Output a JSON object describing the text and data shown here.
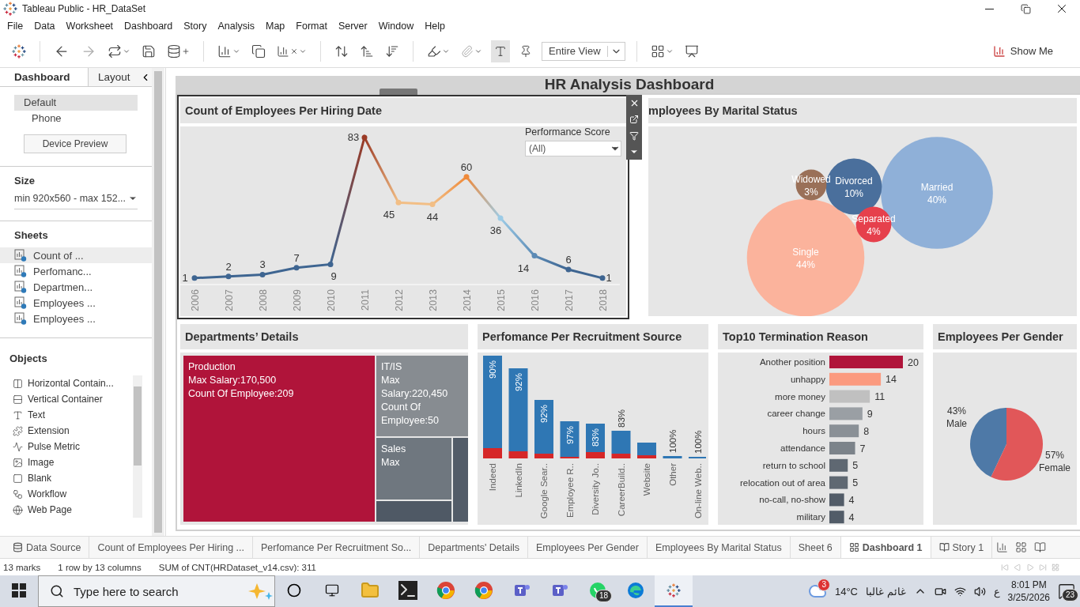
{
  "window": {
    "title": "Tableau Public - HR_DataSet"
  },
  "menu": [
    "File",
    "Data",
    "Worksheet",
    "Dashboard",
    "Story",
    "Analysis",
    "Map",
    "Format",
    "Server",
    "Window",
    "Help"
  ],
  "toolbar": {
    "fit": "Entire View",
    "show_me": "Show Me"
  },
  "side_panel": {
    "tabs": [
      {
        "label": "Dashboard",
        "selected": true
      },
      {
        "label": "Layout",
        "selected": false
      }
    ],
    "devices": [
      {
        "label": "Default",
        "selected": true
      },
      {
        "label": "Phone",
        "selected": false
      }
    ],
    "device_preview": "Device Preview",
    "size": {
      "heading": "Size",
      "value": "min 920x560 - max 152..."
    },
    "sheets": {
      "heading": "Sheets",
      "items": [
        {
          "label": "Count of ...",
          "selected": true
        },
        {
          "label": "Perfomanc...",
          "selected": false
        },
        {
          "label": "Departmen...",
          "selected": false
        },
        {
          "label": "Employees ...",
          "selected": false
        },
        {
          "label": "Employees ...",
          "selected": false
        }
      ]
    },
    "objects": {
      "heading": "Objects",
      "items": [
        {
          "kind": "horizontal",
          "label": "Horizontal Contain..."
        },
        {
          "kind": "vertical",
          "label": "Vertical Container"
        },
        {
          "kind": "text",
          "label": "Text"
        },
        {
          "kind": "extension",
          "label": "Extension"
        },
        {
          "kind": "pulse",
          "label": "Pulse Metric"
        },
        {
          "kind": "image",
          "label": "Image"
        },
        {
          "kind": "blank",
          "label": "Blank"
        },
        {
          "kind": "workflow",
          "label": "Workflow"
        },
        {
          "kind": "webpage",
          "label": "Web Page"
        }
      ]
    }
  },
  "dashboard": {
    "title": "HR Analysis Dashboard",
    "hiring": {
      "title": "Count of Employees Per Hiring Date",
      "selected": true,
      "filter": {
        "label": "Performance Score",
        "value": "(All)"
      },
      "chart_data": {
        "type": "line",
        "categories": [
          "2006",
          "2007",
          "2008",
          "2009",
          "2010",
          "2011",
          "2012",
          "2013",
          "2014",
          "2015",
          "2016",
          "2017",
          "2018"
        ],
        "series": [
          {
            "color": "#3e6591",
            "marker": true,
            "values": [
              1,
              2,
              3,
              7,
              9,
              83,
              45,
              44,
              60,
              36,
              14,
              6,
              1
            ]
          }
        ],
        "data_labels": true
      }
    },
    "marital": {
      "title": "mployees By Marital Status",
      "bubbles": [
        {
          "label": "Single",
          "share": "44%",
          "color": "#fbb39c"
        },
        {
          "label": "Married",
          "share": "40%",
          "color": "#8fb0d8"
        },
        {
          "label": "Divorced",
          "share": "10%",
          "color": "#4a6f9c"
        },
        {
          "label": "Separated",
          "share": "4%",
          "color": "#e6404c"
        },
        {
          "label": "Widowed",
          "share": "3%",
          "color": "#9a7058"
        }
      ]
    },
    "departments": {
      "title": "Departments’ Details",
      "cells": [
        {
          "lines": [
            "Production",
            "Max Salary:170,500",
            "Count Of Employee:209"
          ],
          "color": "#b0143a"
        },
        {
          "lines": [
            "IT/IS",
            "Max Salary:220,450",
            "Count Of Employee:50"
          ],
          "color": "#878c91"
        },
        {
          "lines": [
            "Sales",
            "Max"
          ],
          "color": "#6f777f"
        },
        {
          "color": "#525c68"
        },
        {
          "color": "#4f5965"
        }
      ]
    },
    "recruitment": {
      "title": "Perfomance Per Recruitment Source",
      "sources": [
        {
          "label": "Indeed",
          "share": "90%"
        },
        {
          "label": "LinkedIn",
          "share": "92%"
        },
        {
          "label": "Google Sear..",
          "share": "92%"
        },
        {
          "label": "Employee R..",
          "share": "97%"
        },
        {
          "label": "Diversity Jo..",
          "share": "83%"
        },
        {
          "label": "CareerBuild..",
          "share": "83%"
        },
        {
          "label": "Website"
        },
        {
          "label": "Other",
          "share": "100%"
        },
        {
          "label": "On-line Web..",
          "share": "100%"
        }
      ]
    },
    "termination": {
      "title": "Top10 Termination Reason",
      "chart_data": {
        "type": "bar",
        "orientation": "horizontal",
        "categories": [
          "Another position",
          "unhappy",
          "more money",
          "career change",
          "hours",
          "attendance",
          "return to school",
          "relocation out of area",
          "no-call, no-show",
          "military"
        ],
        "series": [
          {
            "values": [
              20,
              14,
              11,
              9,
              8,
              7,
              5,
              5,
              4,
              4
            ]
          }
        ],
        "colors": [
          "#b0143a",
          "#fb9a7f",
          "#c0c0c0",
          "#9a9fa4",
          "#8a9096",
          "#7c838a",
          "#5f6872",
          "#5f6872",
          "#525c68",
          "#525c68"
        ],
        "data_labels": true
      }
    },
    "gender": {
      "title": "Employees Per Gender",
      "chart_data": {
        "type": "pie",
        "categories": [
          "Male",
          "Female"
        ],
        "values": [
          43,
          57
        ],
        "value_labels": [
          "43%",
          "57%"
        ],
        "colors": [
          "#4e79a7",
          "#e15759"
        ]
      }
    }
  },
  "sheet_tabs": [
    {
      "kind": "datasource",
      "label": "Data Source",
      "selected": false
    },
    {
      "kind": "worksheet",
      "label": "Count of Employees Per Hiring ...",
      "selected": false
    },
    {
      "kind": "worksheet",
      "label": "Perfomance Per Recruitment So...",
      "selected": false
    },
    {
      "kind": "worksheet",
      "label": "Departments' Details",
      "selected": false
    },
    {
      "kind": "worksheet",
      "label": "Employees Per Gender",
      "selected": false
    },
    {
      "kind": "worksheet",
      "label": "Employees By Marital Status",
      "selected": false
    },
    {
      "kind": "worksheet",
      "label": "Sheet 6",
      "selected": false
    },
    {
      "kind": "dashboard",
      "label": "Dashboard 1",
      "selected": true
    },
    {
      "kind": "story",
      "label": "Story 1",
      "selected": false
    }
  ],
  "status_bar": [
    "13 marks",
    "1 row by 13 columns",
    "SUM of CNT(HRDataset_v14.csv): 311"
  ],
  "taskbar": {
    "search": {
      "placeholder": "Type here to search"
    },
    "apps": [
      {
        "kind": "explorer",
        "selected": false
      },
      {
        "kind": "terminal",
        "selected": false
      },
      {
        "kind": "chrome",
        "selected": false
      },
      {
        "kind": "chrome",
        "selected": false
      },
      {
        "kind": "teams",
        "selected": false
      },
      {
        "kind": "teams",
        "selected": false
      },
      {
        "kind": "whatsapp",
        "selected": false,
        "badge": "18"
      },
      {
        "kind": "edge",
        "selected": false
      },
      {
        "kind": "tableau",
        "selected": true
      }
    ],
    "weather": {
      "badge": "3",
      "temperature": "14°C",
      "condition": "غائم غالبا"
    },
    "language": "ع",
    "time": "8:01 PM",
    "date": "3/25/2026",
    "notifications": "23"
  }
}
